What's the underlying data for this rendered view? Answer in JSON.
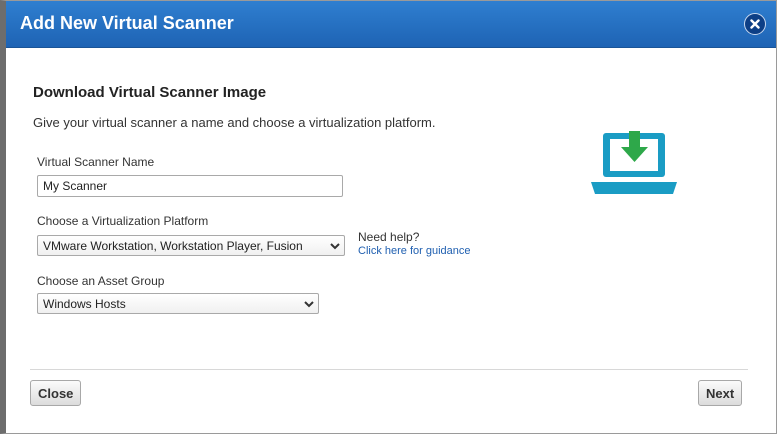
{
  "dialog": {
    "title": "Add New Virtual Scanner",
    "close_icon": "close-icon"
  },
  "content": {
    "heading": "Download Virtual Scanner Image",
    "intro": "Give your virtual scanner a name and choose a virtualization platform.",
    "illustration_icon": "laptop-download-icon",
    "colors": {
      "accent": "#1e63b4",
      "illustration": "#1a9cc4",
      "arrow": "#2ea84a"
    }
  },
  "form": {
    "scanner_name": {
      "label": "Virtual Scanner Name",
      "value": "My Scanner"
    },
    "platform": {
      "label": "Choose a Virtualization Platform",
      "selected": "VMware Workstation, Workstation Player, Fusion"
    },
    "help": {
      "text": "Need help?",
      "link": "Click here for guidance"
    },
    "asset_group": {
      "label": "Choose an Asset Group",
      "selected": "Windows Hosts"
    }
  },
  "footer": {
    "close_label": "Close",
    "next_label": "Next"
  }
}
